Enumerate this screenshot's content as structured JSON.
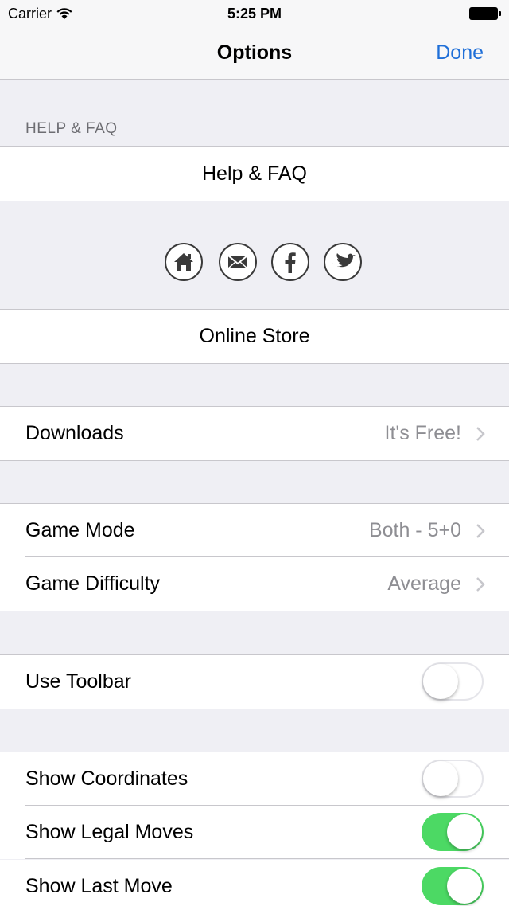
{
  "status_bar": {
    "carrier": "Carrier",
    "time": "5:25 PM"
  },
  "nav": {
    "title": "Options",
    "done": "Done"
  },
  "help_section": {
    "header": "HELP & FAQ",
    "help_label": "Help & FAQ"
  },
  "social_icons": [
    "home-icon",
    "mail-icon",
    "facebook-icon",
    "twitter-icon"
  ],
  "store": {
    "label": "Online Store"
  },
  "downloads": {
    "label": "Downloads",
    "detail": "It's Free!"
  },
  "game": {
    "mode_label": "Game Mode",
    "mode_value": "Both - 5+0",
    "difficulty_label": "Game Difficulty",
    "difficulty_value": "Average"
  },
  "toolbar": {
    "label": "Use Toolbar",
    "on": false
  },
  "display": {
    "coordinates_label": "Show Coordinates",
    "coordinates_on": false,
    "legal_moves_label": "Show Legal Moves",
    "legal_moves_on": true,
    "last_move_label": "Show Last Move",
    "last_move_on": true
  },
  "colors": {
    "accent": "#1f6fd8",
    "toggle_on": "#4cd964",
    "grouped_bg": "#efeff4"
  }
}
